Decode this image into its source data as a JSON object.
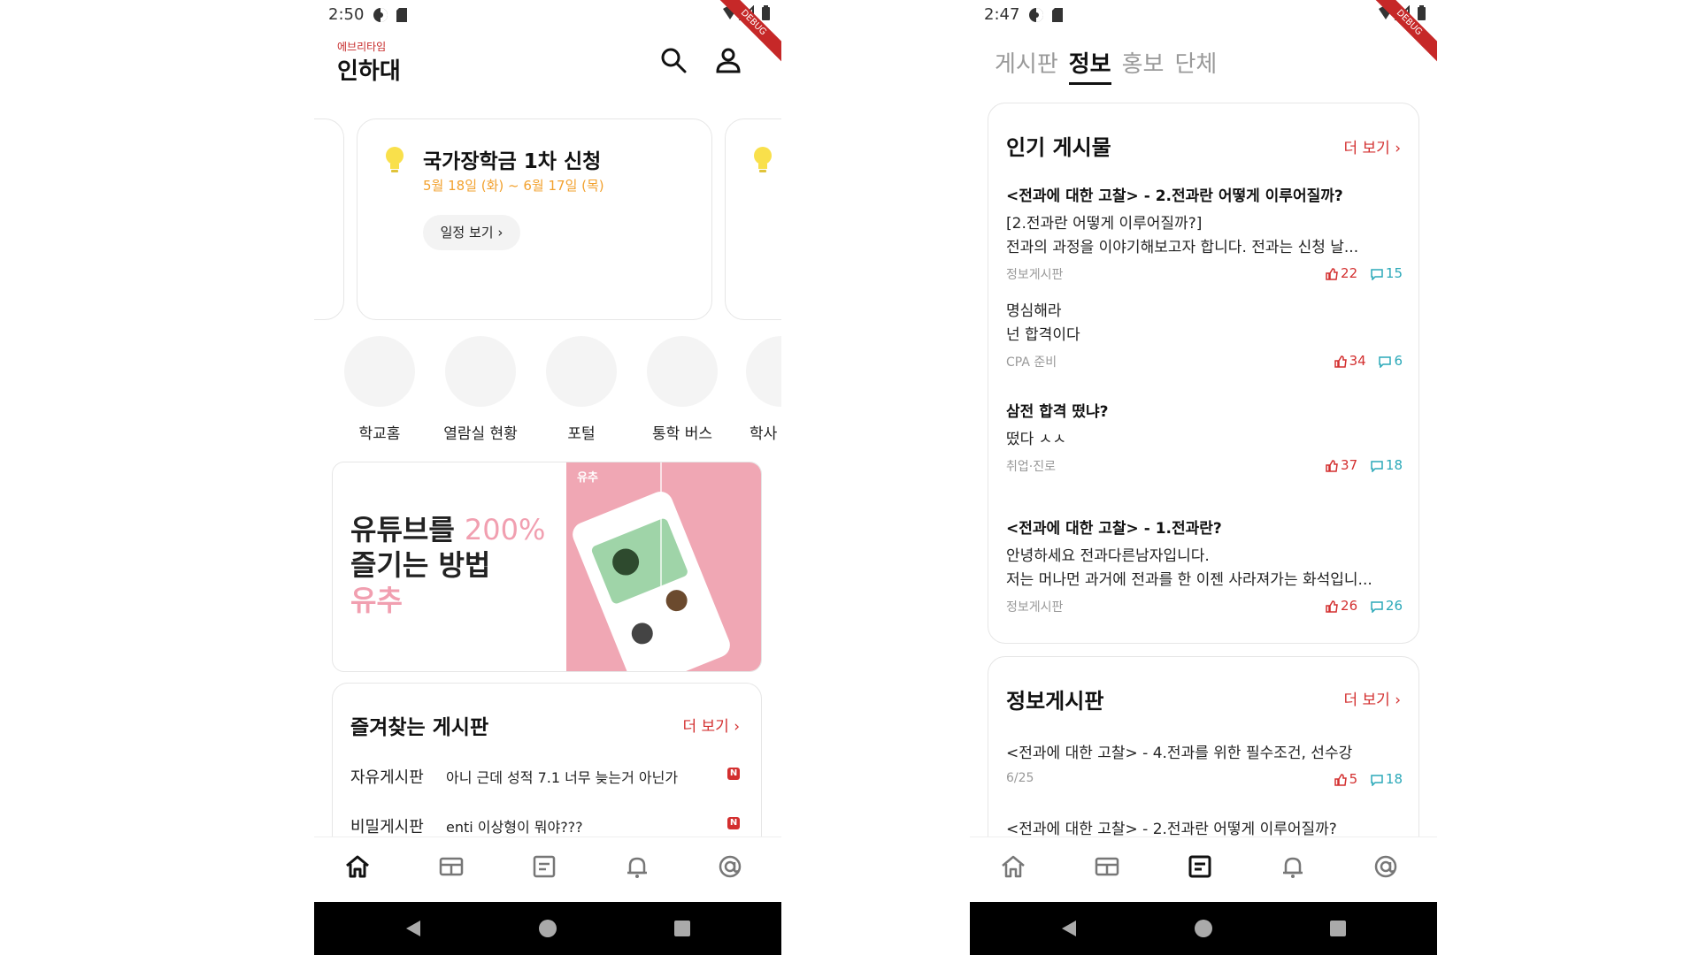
{
  "phone1": {
    "status": {
      "time": "2:50"
    },
    "debug_label": "DEBUG",
    "app": {
      "subtitle": "에브리타임",
      "title": "인하대"
    },
    "schedule": {
      "title": "국가장학금 1차 신청",
      "date": "5월 18일 (화) ~ 6월 17일 (목)",
      "button": "일정 보기 ›"
    },
    "quick_links": [
      {
        "label": "학교홈"
      },
      {
        "label": "열람실 현황"
      },
      {
        "label": "포털"
      },
      {
        "label": "통학 버스"
      },
      {
        "label": "학사"
      }
    ],
    "banner": {
      "line1": "유튜브를 ",
      "line1_accent": "200%",
      "line2": "즐기는 방법",
      "line3": "유추",
      "image_label": "유추"
    },
    "favorites": {
      "title": "즐겨찾는 게시판",
      "more": "더 보기 ›",
      "rows": [
        {
          "board": "자유게시판",
          "title": "아니 근데 성적 7.1 너무 늦는거 아닌가",
          "badge": "N"
        },
        {
          "board": "비밀게시판",
          "title": "enti 이상형이 뭐야???",
          "badge": "N"
        }
      ]
    },
    "colors": {
      "accent": "#d32f2f",
      "date": "#f2a12e",
      "banner_pink": "#f0a7b4",
      "banner_text_accent": "#f19fb0"
    }
  },
  "phone2": {
    "status": {
      "time": "2:47"
    },
    "debug_label": "DEBUG",
    "tabs": [
      {
        "label": "게시판",
        "active": false
      },
      {
        "label": "정보",
        "active": true
      },
      {
        "label": "홍보",
        "active": false
      },
      {
        "label": "단체",
        "active": false
      }
    ],
    "popular": {
      "title": "인기 게시물",
      "more": "더 보기 ›",
      "posts": [
        {
          "title": "<전과에 대한 고찰> - 2.전과란 어떻게 이루어질까?",
          "body1": "[2.전과란 어떻게 이루어질까?]",
          "body2": "전과의 과정을 이야기해보고자 합니다. 전과는 신청 날...",
          "board": "정보게시판",
          "likes": "22",
          "comments": "15"
        },
        {
          "title": "명심해라",
          "body1": "넌 합격이다",
          "board": "CPA 준비",
          "likes": "34",
          "comments": "6"
        },
        {
          "title": "삼전 합격 떴냐?",
          "body1": "떴다 ㅅㅅ",
          "board": "취업·진로",
          "likes": "37",
          "comments": "18"
        },
        {
          "title": "<전과에 대한 고찰> - 1.전과란?",
          "body1": "안녕하세요 전과다른남자입니다.",
          "body2": "저는 머나먼 과거에 전과를 한 이젠 사라져가는 화석입니...",
          "board": "정보게시판",
          "likes": "26",
          "comments": "26"
        }
      ]
    },
    "info_board": {
      "title": "정보게시판",
      "more": "더 보기 ›",
      "posts": [
        {
          "title": "<전과에 대한 고찰> - 4.전과를 위한 필수조건, 선수강",
          "date": "6/25",
          "likes": "5",
          "comments": "18"
        },
        {
          "title": "<전과에 대한 고찰> - 2.전과란 어떻게 이루어질까?"
        }
      ]
    }
  }
}
